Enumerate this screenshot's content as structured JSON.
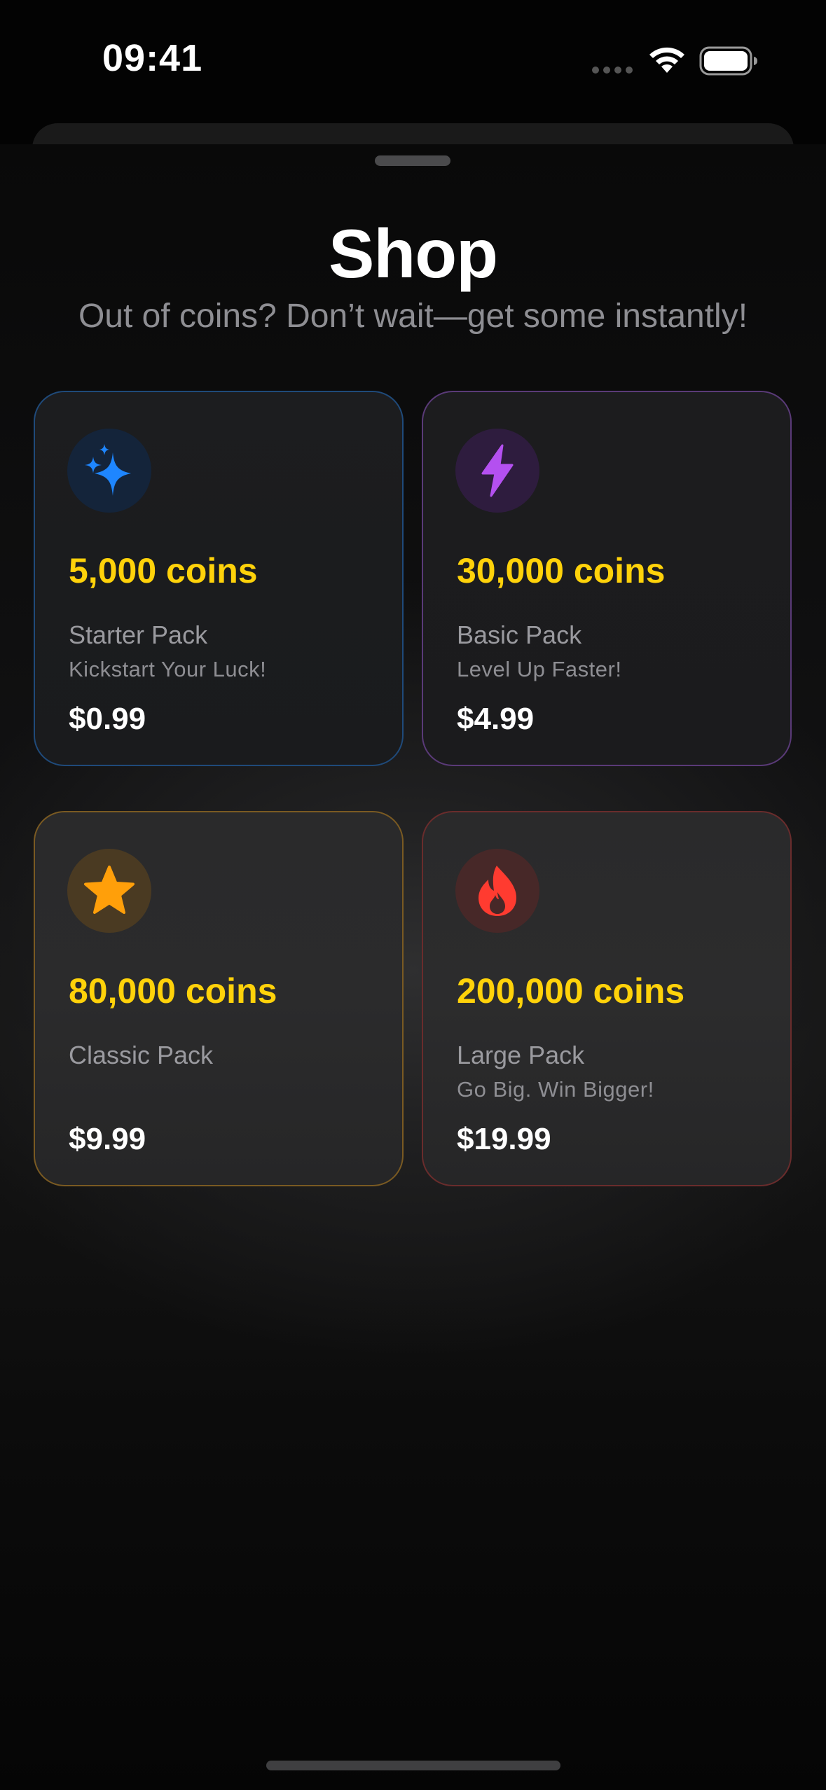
{
  "status_bar": {
    "time": "09:41",
    "icons": [
      "signal-dots-icon",
      "wifi-icon",
      "battery-icon"
    ]
  },
  "header": {
    "title": "Shop",
    "subtitle": "Out of coins? Don’t wait—get some instantly!"
  },
  "packs": [
    {
      "coins": "5,000 coins",
      "name": "Starter Pack",
      "tagline": "Kickstart Your Luck!",
      "price": "$0.99",
      "icon": "sparkles-icon",
      "accent": "#1e86ff"
    },
    {
      "coins": "30,000 coins",
      "name": "Basic Pack",
      "tagline": "Level Up Faster!",
      "price": "$4.99",
      "icon": "lightning-bolt-icon",
      "accent": "#b450f0"
    },
    {
      "coins": "80,000 coins",
      "name": "Classic Pack",
      "tagline": "",
      "price": "$9.99",
      "icon": "star-icon",
      "accent": "#ff9f0a"
    },
    {
      "coins": "200,000 coins",
      "name": "Large Pack",
      "tagline": "Go Big. Win Bigger!",
      "price": "$19.99",
      "icon": "flame-icon",
      "accent": "#ff3b30"
    }
  ],
  "colors": {
    "coins": "#ffd20a",
    "background": "#030303",
    "secondary_text": "#8e8e93"
  }
}
